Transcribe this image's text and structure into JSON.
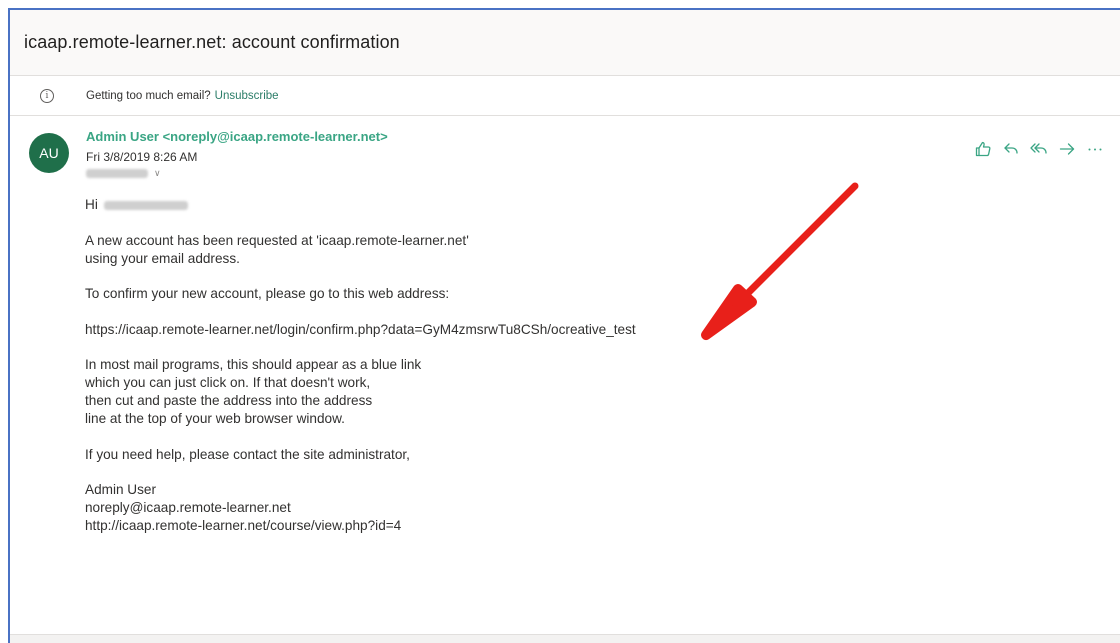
{
  "email": {
    "subject": "icaap.remote-learner.net: account confirmation",
    "notice": {
      "text": "Getting too much email?",
      "link": "Unsubscribe"
    },
    "avatar_initials": "AU",
    "sender": "Admin User <noreply@icaap.remote-learner.net>",
    "date": "Fri 3/8/2019 8:26 AM",
    "greeting": "Hi",
    "paragraphs": [
      [
        "A new account has been requested at 'icaap.remote-learner.net'",
        "using your email address."
      ],
      [
        "To confirm your new account, please go to this web address:"
      ],
      [
        "https://icaap.remote-learner.net/login/confirm.php?data=GyM4zmsrwTu8CSh/ocreative_test"
      ],
      [
        "In most mail programs, this should appear as a blue link",
        "which you can just click on. If that doesn't work,",
        "then cut and paste the address into the address",
        "line at the top of your web browser window."
      ],
      [
        "If you need help, please contact the site administrator,"
      ],
      [
        "Admin User",
        "noreply@icaap.remote-learner.net",
        "http://icaap.remote-learner.net/course/view.php?id=4"
      ]
    ]
  },
  "icons": {
    "info": "info-icon",
    "like": "thumbs-up-icon",
    "reply": "reply-icon",
    "reply_all": "reply-all-icon",
    "forward": "forward-icon",
    "more": "more-icon"
  },
  "colors": {
    "accent_green": "#3aa584",
    "avatar_bg": "#1f6f4a",
    "annotation_arrow": "#e8201a",
    "frame_border": "#4a72c4"
  }
}
